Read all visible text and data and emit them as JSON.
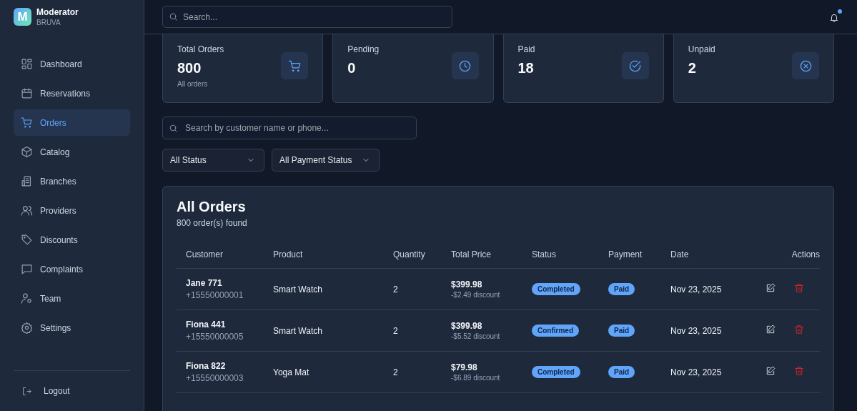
{
  "sidebar": {
    "brand": {
      "logo": "M",
      "title": "Moderator",
      "subtitle": "BRUVA"
    },
    "items": [
      {
        "label": "Dashboard",
        "selected": false
      },
      {
        "label": "Reservations",
        "selected": false
      },
      {
        "label": "Orders",
        "selected": true
      },
      {
        "label": "Catalog",
        "selected": false
      },
      {
        "label": "Branches",
        "selected": false
      },
      {
        "label": "Providers",
        "selected": false
      },
      {
        "label": "Discounts",
        "selected": false
      },
      {
        "label": "Complaints",
        "selected": false
      },
      {
        "label": "Team",
        "selected": false
      },
      {
        "label": "Settings",
        "selected": false
      }
    ],
    "logout": "Logout"
  },
  "top_bar": {
    "search": {
      "placeholder": "Search..."
    },
    "notifications": {
      "unread": true
    }
  },
  "stats": [
    {
      "label": "Total Orders",
      "value": "800",
      "note": "All orders"
    },
    {
      "label": "Pending",
      "value": "0"
    },
    {
      "label": "Paid",
      "value": "18"
    },
    {
      "label": "Unpaid",
      "value": "2"
    }
  ],
  "filters": {
    "search": {
      "placeholder": "Search by customer name or phone..."
    },
    "status": "All Status",
    "payment_status": "All Payment Status"
  },
  "table": {
    "title": "All Orders",
    "subtitle": "800 order(s) found",
    "columns": [
      "Customer",
      "Product",
      "Quantity",
      "Total Price",
      "Status",
      "Payment",
      "Date",
      "Actions"
    ],
    "rows": [
      {
        "name": "Jane 771",
        "phone": "+15550000001",
        "product": "Smart Watch",
        "quantity": "2",
        "price": "$399.98",
        "discount": "-$2.49 discount",
        "status": "Completed",
        "payment": "Paid",
        "date": "Nov 23, 2025"
      },
      {
        "name": "Fiona 441",
        "phone": "+15550000005",
        "product": "Smart Watch",
        "quantity": "2",
        "price": "$399.98",
        "discount": "-$5.52 discount",
        "status": "Confirmed",
        "payment": "Paid",
        "date": "Nov 23, 2025"
      },
      {
        "name": "Fiona 822",
        "phone": "+15550000003",
        "product": "Yoga Mat",
        "quantity": "2",
        "price": "$79.98",
        "discount": "-$6.89 discount",
        "status": "Completed",
        "payment": "Paid",
        "date": "Nov 23, 2025"
      }
    ]
  }
}
